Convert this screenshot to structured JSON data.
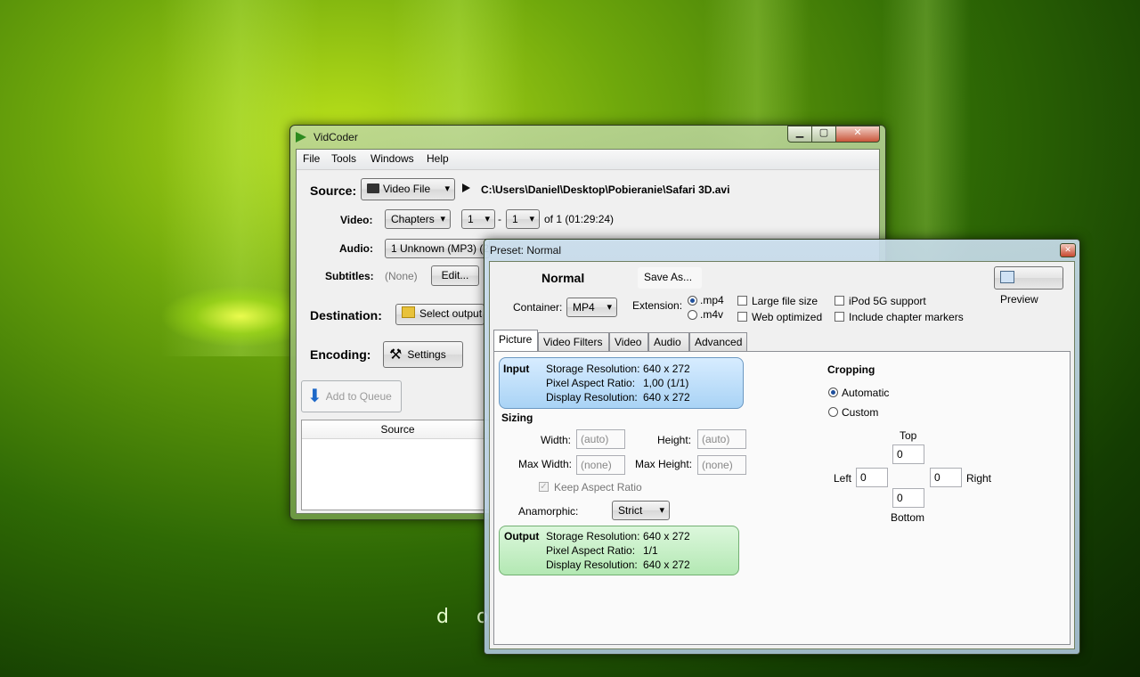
{
  "wallpaper": {
    "text": "d o"
  },
  "main_window": {
    "title": "VidCoder",
    "controls": {
      "minimize": "▁",
      "maximize": "▢",
      "close": "✕"
    },
    "menu": [
      "File",
      "Tools",
      "Windows",
      "Help"
    ],
    "source": {
      "label": "Source:",
      "type_value": "Video File",
      "path": "C:\\Users\\Daniel\\Desktop\\Pobieranie\\Safari 3D.avi"
    },
    "video": {
      "label": "Video:",
      "range_type": "Chapters",
      "start": "1",
      "dash": "-",
      "end": "1",
      "of_text": "of 1 (01:29:24)"
    },
    "audio": {
      "label": "Audio:",
      "value": "1 Unknown (MP3) (2"
    },
    "subtitles": {
      "label": "Subtitles:",
      "value": "(None)",
      "edit_button": "Edit..."
    },
    "destination": {
      "label": "Destination:",
      "button": "Select output"
    },
    "encoding": {
      "label": "Encoding:",
      "button": "Settings"
    },
    "queue": {
      "add_button": "Add to Queue",
      "column_source": "Source"
    }
  },
  "preset_window": {
    "title": "Preset: Normal",
    "close": "✕",
    "preset_name": "Normal",
    "save_as": "Save As...",
    "preview_button": "Preview",
    "container": {
      "label": "Container:",
      "value": "MP4"
    },
    "extension": {
      "label": "Extension:",
      "options": [
        ".mp4",
        ".m4v"
      ],
      "selected": ".mp4"
    },
    "checkboxes": {
      "large_file_size": "Large file size",
      "web_optimized": "Web optimized",
      "ipod_5g": "iPod 5G support",
      "chapter_markers": "Include chapter markers"
    },
    "tabs": [
      "Picture",
      "Video Filters",
      "Video",
      "Audio",
      "Advanced"
    ],
    "active_tab": "Picture",
    "input_box": {
      "title": "Input",
      "storage_label": "Storage Resolution:",
      "storage_value": "640 x 272",
      "par_label": "Pixel Aspect Ratio:",
      "par_value": "1,00 (1/1)",
      "display_label": "Display Resolution:",
      "display_value": "640 x 272"
    },
    "sizing": {
      "title": "Sizing",
      "width_label": "Width:",
      "width_value": "(auto)",
      "height_label": "Height:",
      "height_value": "(auto)",
      "max_width_label": "Max Width:",
      "max_width_value": "(none)",
      "max_height_label": "Max Height:",
      "max_height_value": "(none)",
      "keep_aspect": "Keep Aspect Ratio",
      "anamorphic_label": "Anamorphic:",
      "anamorphic_value": "Strict"
    },
    "output_box": {
      "title": "Output",
      "storage_label": "Storage Resolution:",
      "storage_value": "640 x 272",
      "par_label": "Pixel Aspect Ratio:",
      "par_value": "1/1",
      "display_label": "Display Resolution:",
      "display_value": "640 x 272"
    },
    "cropping": {
      "title": "Cropping",
      "automatic": "Automatic",
      "custom": "Custom",
      "selected": "Automatic",
      "top_label": "Top",
      "top_value": "0",
      "left_label": "Left",
      "left_value": "0",
      "right_label": "Right",
      "right_value": "0",
      "bottom_label": "Bottom",
      "bottom_value": "0"
    }
  }
}
